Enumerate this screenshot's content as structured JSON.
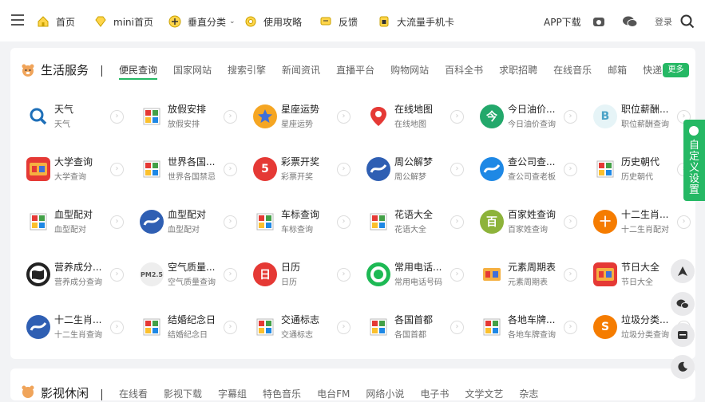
{
  "nav": {
    "items": [
      {
        "label": "首页",
        "icon": "home-icon"
      },
      {
        "label": "mini首页",
        "icon": "diamond-icon"
      },
      {
        "label": "垂直分类",
        "icon": "plus-circle-icon"
      },
      {
        "label": "使用攻略",
        "icon": "gear-icon"
      },
      {
        "label": "反馈",
        "icon": "message-icon"
      },
      {
        "label": "大流量手机卡",
        "icon": "sim-card-icon"
      }
    ],
    "app_download": "APP下载",
    "login": "登录"
  },
  "life": {
    "title": "生活服务",
    "tabs": [
      "便民查询",
      "国家网站",
      "搜索引擎",
      "新闻资讯",
      "直播平台",
      "购物网站",
      "百科全书",
      "求职招聘",
      "在线音乐",
      "邮箱",
      "快递"
    ],
    "more": "更多",
    "tiles": [
      {
        "title": "天气",
        "sub": "天气",
        "logo": "search-icon",
        "color": "#ffffff"
      },
      {
        "title": "放假安排",
        "sub": "放假安排",
        "logo": "placeholder-image-icon",
        "color": "#ffffff"
      },
      {
        "title": "星座运势",
        "sub": "星座运势",
        "logo": "star-icon",
        "color": "#f5a623"
      },
      {
        "title": "在线地图",
        "sub": "在线地图",
        "logo": "map-pin-icon",
        "color": "#ffffff"
      },
      {
        "title": "今日油价...",
        "sub": "今日油价查询",
        "logo": "今",
        "color": "#23a86b"
      },
      {
        "title": "职位薪酬...",
        "sub": "职位薪酬查询",
        "logo": "B",
        "color": "#e6f4f7"
      },
      {
        "title": "大学查询",
        "sub": "大学查询",
        "logo": "university-icon",
        "color": "#e53935"
      },
      {
        "title": "世界各国...",
        "sub": "世界各国禁忌",
        "logo": "placeholder-image-icon",
        "color": "#ffffff"
      },
      {
        "title": "彩票开奖",
        "sub": "彩票开奖",
        "logo": "5",
        "color": "#e53935"
      },
      {
        "title": "周公解梦",
        "sub": "周公解梦",
        "logo": "wave-icon",
        "color": "#2f5fb3"
      },
      {
        "title": "查公司查...",
        "sub": "查公司查老板",
        "logo": "arc-icon",
        "color": "#1e88e5"
      },
      {
        "title": "历史朝代",
        "sub": "历史朝代",
        "logo": "placeholder-image-icon",
        "color": "#ffffff"
      },
      {
        "title": "血型配对",
        "sub": "血型配对",
        "logo": "placeholder-image-icon",
        "color": "#ffffff"
      },
      {
        "title": "血型配对",
        "sub": "血型配对",
        "logo": "wave-icon",
        "color": "#2f5fb3"
      },
      {
        "title": "车标查询",
        "sub": "车标查询",
        "logo": "placeholder-image-icon",
        "color": "#ffffff"
      },
      {
        "title": "花语大全",
        "sub": "花语大全",
        "logo": "placeholder-image-icon",
        "color": "#ffffff"
      },
      {
        "title": "百家姓查询",
        "sub": "百家姓查询",
        "logo": "百",
        "color": "#8db33a"
      },
      {
        "title": "十二生肖...",
        "sub": "十二生肖配对",
        "logo": "十",
        "color": "#f57c00"
      },
      {
        "title": "营养成分...",
        "sub": "营养成分查询",
        "logo": "globe-icon",
        "color": "#222222"
      },
      {
        "title": "空气质量...",
        "sub": "空气质量查询",
        "logo": "PM2.5",
        "color": "#eeeeee"
      },
      {
        "title": "日历",
        "sub": "日历",
        "logo": "日",
        "color": "#e53935"
      },
      {
        "title": "常用电话...",
        "sub": "常用电话号码",
        "logo": "ring-icon",
        "color": "#1db954"
      },
      {
        "title": "元素周期表",
        "sub": "元素周期表",
        "logo": "periodic-table-icon",
        "color": "#ffffff"
      },
      {
        "title": "节日大全",
        "sub": "节日大全",
        "logo": "festival-icon",
        "color": "#e53935"
      },
      {
        "title": "十二生肖...",
        "sub": "十二生肖查询",
        "logo": "wave-icon",
        "color": "#2f5fb3"
      },
      {
        "title": "结婚纪念日",
        "sub": "结婚纪念日",
        "logo": "placeholder-image-icon",
        "color": "#ffffff"
      },
      {
        "title": "交通标志",
        "sub": "交通标志",
        "logo": "placeholder-image-icon",
        "color": "#ffffff"
      },
      {
        "title": "各国首都",
        "sub": "各国首都",
        "logo": "placeholder-image-icon",
        "color": "#ffffff"
      },
      {
        "title": "各地车牌...",
        "sub": "各地车牌查询",
        "logo": "placeholder-image-icon",
        "color": "#ffffff"
      },
      {
        "title": "垃圾分类...",
        "sub": "垃圾分类查询",
        "logo": "S",
        "color": "#f57c00"
      }
    ]
  },
  "movie": {
    "title": "影视休闲",
    "tabs": [
      "在线看",
      "影视下载",
      "字幕组",
      "特色音乐",
      "电台FM",
      "网络小说",
      "电子书",
      "文学文艺",
      "杂志"
    ]
  },
  "side": {
    "custom": "自定义设置"
  }
}
